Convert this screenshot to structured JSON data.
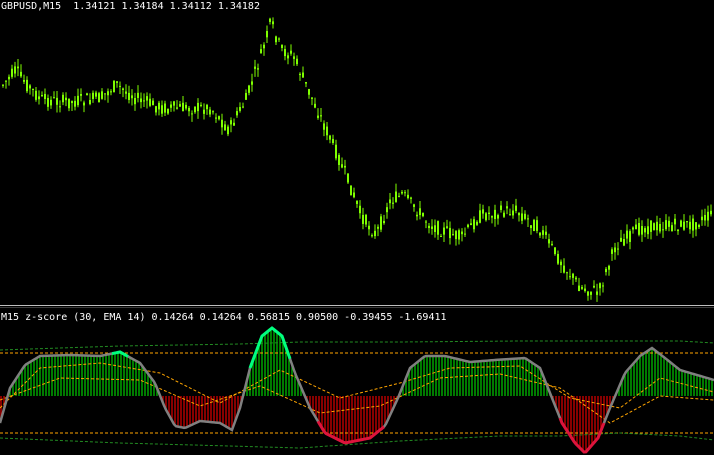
{
  "price_panel": {
    "legend_symbol": "GBPUSD,M15",
    "legend_values": [
      "1.34121",
      "1.34184",
      "1.34112",
      "1.34182"
    ]
  },
  "indicator_panel": {
    "legend": "M15 z-score (30, EMA 14) 0.14264 0.14264 0.56815 0.90500 -0.39455 -1.69411"
  },
  "colors": {
    "background": "#000000",
    "bull_candle": "#7fff00",
    "bear_candle": "#7fff00",
    "hist_pos": "#00b000",
    "hist_neg": "#c00000",
    "zline": "#808080",
    "zline_up": "#00ff7f",
    "zline_down": "#dc143c",
    "band_dash": "#ffa500",
    "band_dash_green": "#228b22",
    "text": "#ffffff"
  }
}
